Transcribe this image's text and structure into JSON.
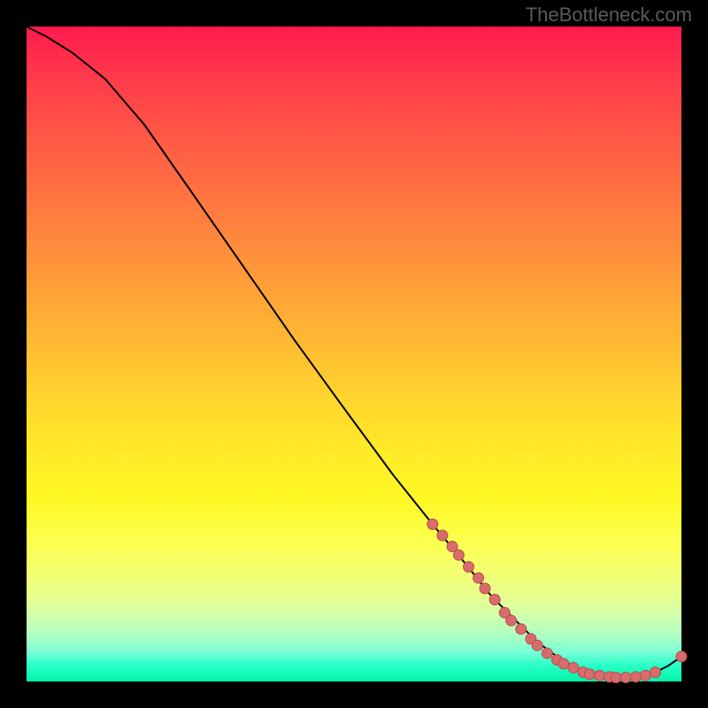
{
  "watermark": "TheBottleneck.com",
  "chart_data": {
    "type": "line",
    "title": "",
    "xlabel": "",
    "ylabel": "",
    "xlim": [
      0,
      100
    ],
    "ylim": [
      0,
      100
    ],
    "grid": false,
    "legend": false,
    "colors": {
      "background_gradient_top": "#ff1a4d",
      "background_gradient_bottom": "#00f5a8",
      "curve": "#000000",
      "marker": "#d86b6b"
    },
    "series": [
      {
        "name": "curve",
        "x": [
          0,
          3,
          7,
          12,
          18,
          25,
          33,
          41,
          49,
          56,
          62,
          67,
          71,
          75,
          78,
          81,
          83.5,
          86,
          88,
          90,
          92,
          94,
          96,
          98,
          100
        ],
        "y": [
          100,
          98.5,
          96,
          92,
          85,
          75,
          63.5,
          52,
          41,
          31.5,
          24,
          18,
          13,
          9,
          6,
          3.8,
          2.3,
          1.3,
          0.8,
          0.6,
          0.6,
          0.8,
          1.4,
          2.4,
          3.8
        ]
      }
    ],
    "markers": {
      "name": "highlighted-points",
      "points": [
        {
          "x": 62,
          "y": 24
        },
        {
          "x": 63.5,
          "y": 22.3
        },
        {
          "x": 65,
          "y": 20.6
        },
        {
          "x": 66,
          "y": 19.3
        },
        {
          "x": 67.5,
          "y": 17.5
        },
        {
          "x": 69,
          "y": 15.8
        },
        {
          "x": 70,
          "y": 14.2
        },
        {
          "x": 71.5,
          "y": 12.5
        },
        {
          "x": 73,
          "y": 10.5
        },
        {
          "x": 74,
          "y": 9.3
        },
        {
          "x": 75.5,
          "y": 8
        },
        {
          "x": 77,
          "y": 6.5
        },
        {
          "x": 78,
          "y": 5.5
        },
        {
          "x": 79.5,
          "y": 4.3
        },
        {
          "x": 81,
          "y": 3.3
        },
        {
          "x": 82,
          "y": 2.7
        },
        {
          "x": 83.5,
          "y": 2.1
        },
        {
          "x": 85,
          "y": 1.4
        },
        {
          "x": 86,
          "y": 1.1
        },
        {
          "x": 87.5,
          "y": 0.9
        },
        {
          "x": 89,
          "y": 0.7
        },
        {
          "x": 90,
          "y": 0.6
        },
        {
          "x": 91.5,
          "y": 0.6
        },
        {
          "x": 93,
          "y": 0.7
        },
        {
          "x": 94.5,
          "y": 0.9
        },
        {
          "x": 96,
          "y": 1.4
        },
        {
          "x": 100,
          "y": 3.8
        }
      ]
    }
  }
}
